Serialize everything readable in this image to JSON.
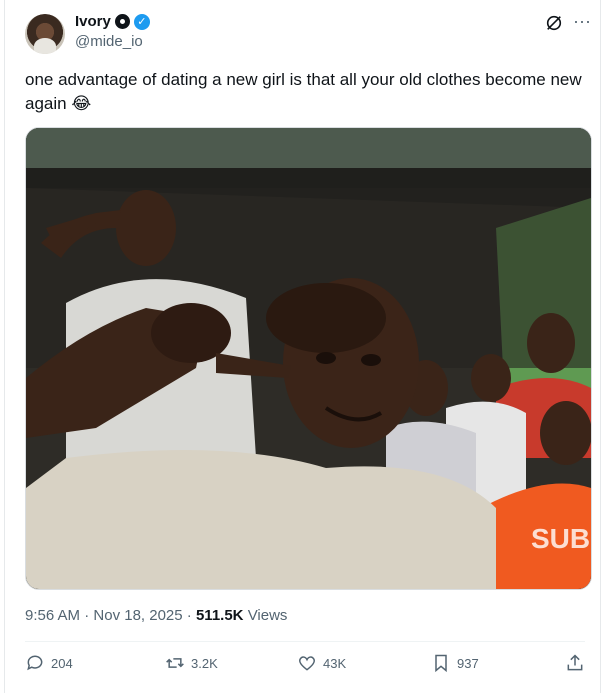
{
  "author": {
    "name": "Ivory",
    "handle": "@mide_io"
  },
  "tweet": {
    "text": "one advantage of dating a new girl is that all your old clothes become new again 😂"
  },
  "meta": {
    "time": "9:56 AM",
    "separator": "·",
    "date": "Nov 18, 2025",
    "separator2": "·",
    "views_count": "511.5K",
    "views_label": "Views"
  },
  "actions": {
    "replies": "204",
    "reposts": "3.2K",
    "likes": "43K",
    "bookmarks": "937"
  },
  "colors": {
    "accent": "#1d9bf0",
    "text": "#0f1419",
    "muted": "#536471"
  }
}
